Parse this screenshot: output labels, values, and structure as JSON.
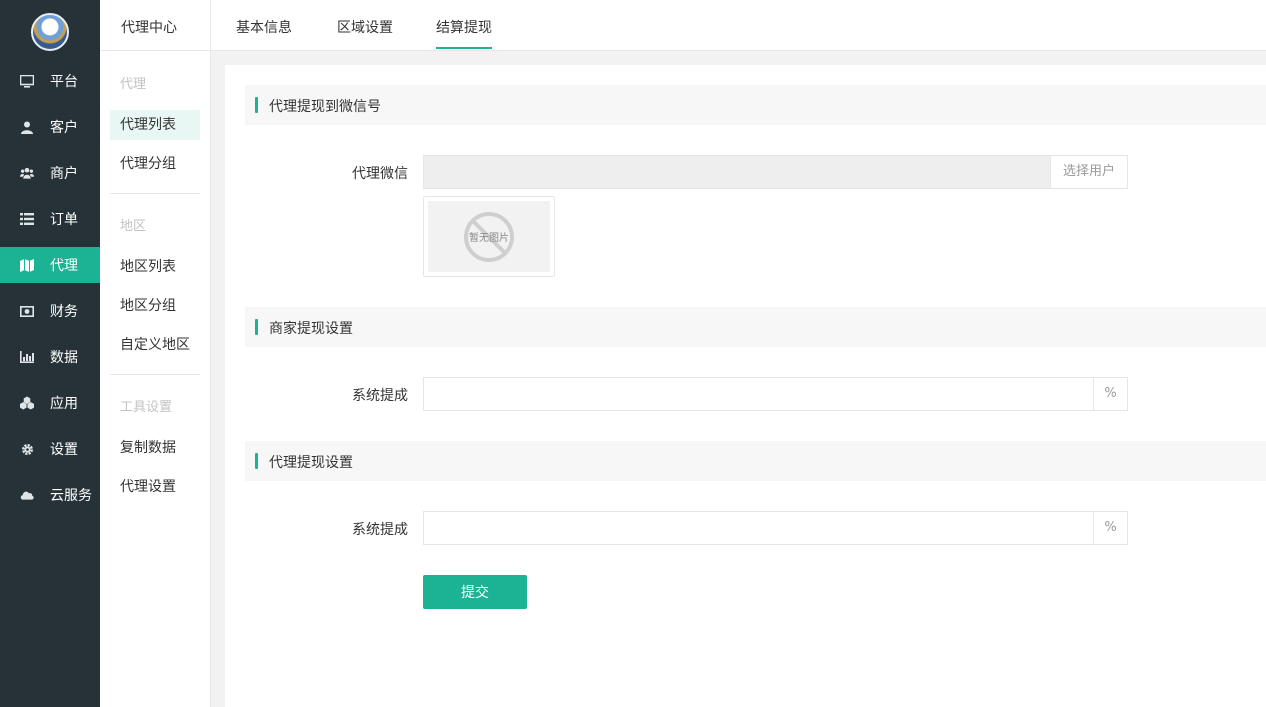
{
  "nav": {
    "items": [
      {
        "label": "平台",
        "icon": "monitor-icon"
      },
      {
        "label": "客户",
        "icon": "user-icon"
      },
      {
        "label": "商户",
        "icon": "users-icon"
      },
      {
        "label": "订单",
        "icon": "list-icon"
      },
      {
        "label": "代理",
        "icon": "map-icon",
        "active": true
      },
      {
        "label": "财务",
        "icon": "money-icon"
      },
      {
        "label": "数据",
        "icon": "bar-chart-icon"
      },
      {
        "label": "应用",
        "icon": "cubes-icon"
      },
      {
        "label": "设置",
        "icon": "gear-icon"
      },
      {
        "label": "云服务",
        "icon": "cloud-icon"
      }
    ]
  },
  "sub": {
    "title": "代理中心",
    "groups": [
      {
        "name": "代理",
        "items": [
          "代理列表",
          "代理分组"
        ]
      },
      {
        "name": "地区",
        "items": [
          "地区列表",
          "地区分组",
          "自定义地区"
        ]
      },
      {
        "name": "工具设置",
        "items": [
          "复制数据",
          "代理设置"
        ]
      }
    ],
    "active_item": "代理列表"
  },
  "tabs": [
    {
      "label": "基本信息"
    },
    {
      "label": "区域设置"
    },
    {
      "label": "结算提现",
      "active": true
    }
  ],
  "form": {
    "section1": {
      "title": "代理提现到微信号"
    },
    "wechat": {
      "label": "代理微信",
      "value": "",
      "addon": "选择用户",
      "no_image": "暂无图片"
    },
    "section2": {
      "title": "商家提现设置"
    },
    "merchant_rate": {
      "label": "系统提成",
      "value": "",
      "addon": "%"
    },
    "section3": {
      "title": "代理提现设置"
    },
    "agent_rate": {
      "label": "系统提成",
      "value": "",
      "addon": "%"
    },
    "submit_label": "提交"
  },
  "colors": {
    "accent": "#1bb394",
    "nav_bg": "#263238"
  }
}
